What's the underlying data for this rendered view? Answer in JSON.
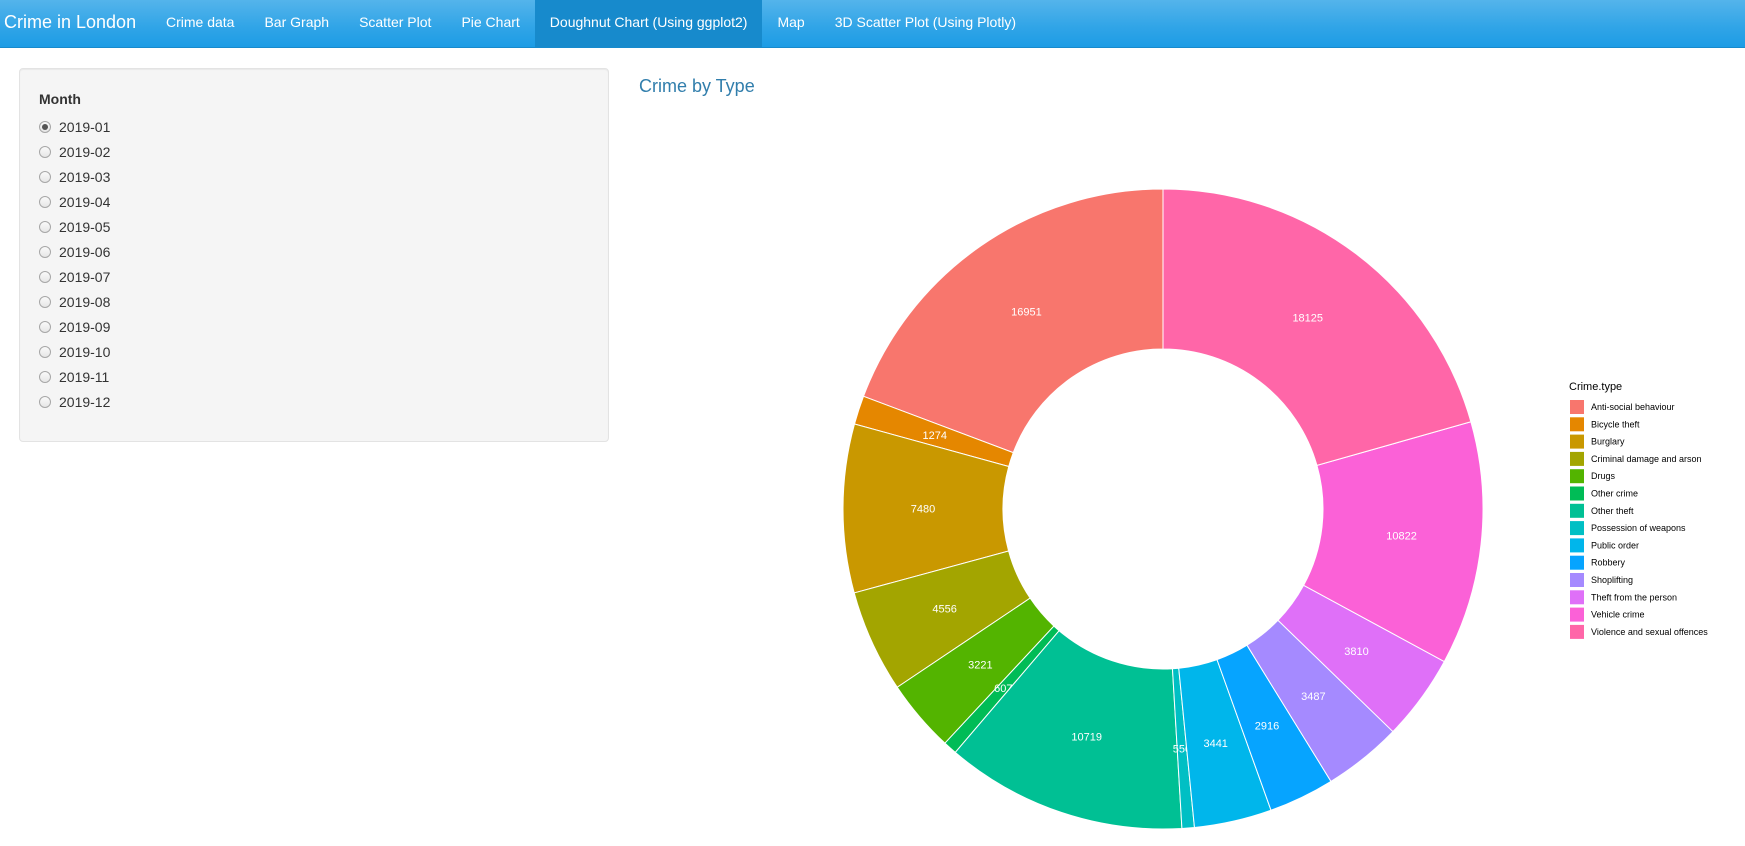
{
  "navbar": {
    "brand": "Crime in London",
    "tabs": [
      {
        "label": "Crime data",
        "active": false
      },
      {
        "label": "Bar Graph",
        "active": false
      },
      {
        "label": "Scatter Plot",
        "active": false
      },
      {
        "label": "Pie Chart",
        "active": false
      },
      {
        "label": "Doughnut Chart (Using ggplot2)",
        "active": true
      },
      {
        "label": "Map",
        "active": false
      },
      {
        "label": "3D Scatter Plot (Using Plotly)",
        "active": false
      }
    ]
  },
  "sidebar": {
    "label": "Month",
    "options": [
      "2019-01",
      "2019-02",
      "2019-03",
      "2019-04",
      "2019-05",
      "2019-06",
      "2019-07",
      "2019-08",
      "2019-09",
      "2019-10",
      "2019-11",
      "2019-12"
    ],
    "selected": "2019-01"
  },
  "main": {
    "title": "Crime by Type"
  },
  "colors": {
    "navbar": "#2fa4e7",
    "active_tab": "#178acc",
    "title": "#317eac"
  },
  "chart_data": {
    "type": "pie",
    "style": "doughnut",
    "legend_title": "Crime.type",
    "legend_position": "right",
    "slices": [
      {
        "label": "Anti-social behaviour",
        "value": 16951,
        "color": "#F8766D"
      },
      {
        "label": "Bicycle theft",
        "value": 1274,
        "color": "#E58700"
      },
      {
        "label": "Burglary",
        "value": 7480,
        "color": "#C99800"
      },
      {
        "label": "Criminal damage and arson",
        "value": 4556,
        "color": "#A3A500"
      },
      {
        "label": "Drugs",
        "value": 3221,
        "color": "#53B400"
      },
      {
        "label": "Other crime",
        "value": 607,
        "color": "#00BC56"
      },
      {
        "label": "Other theft",
        "value": 10719,
        "color": "#00C094"
      },
      {
        "label": "Possession of weapons",
        "value": 550,
        "color": "#00BFC4"
      },
      {
        "label": "Public order",
        "value": 3441,
        "color": "#00B6EB"
      },
      {
        "label": "Robbery",
        "value": 2916,
        "color": "#06A4FF"
      },
      {
        "label": "Shoplifting",
        "value": 3487,
        "color": "#A58AFF"
      },
      {
        "label": "Theft from the person",
        "value": 3810,
        "color": "#DF70F8"
      },
      {
        "label": "Vehicle crime",
        "value": 10822,
        "color": "#FB61D7"
      },
      {
        "label": "Violence and sexual offences",
        "value": 18125,
        "color": "#FF66A8"
      }
    ]
  }
}
